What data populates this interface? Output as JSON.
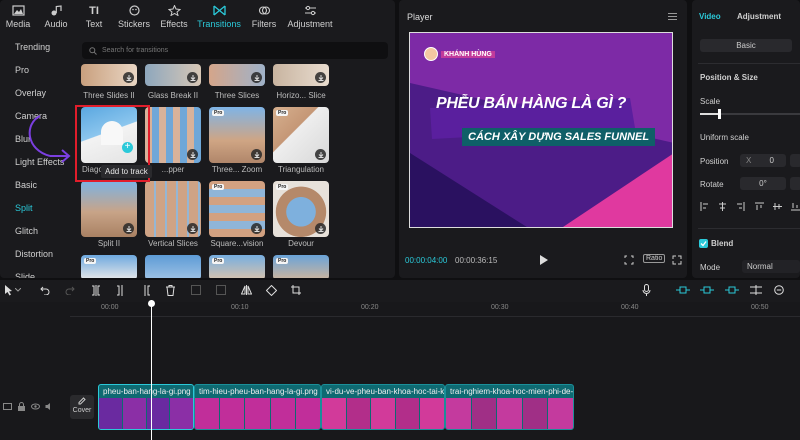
{
  "top_tabs": [
    {
      "label": "Media",
      "icon": "media-icon"
    },
    {
      "label": "Audio",
      "icon": "audio-icon"
    },
    {
      "label": "Text",
      "icon": "text-icon"
    },
    {
      "label": "Stickers",
      "icon": "stickers-icon"
    },
    {
      "label": "Effects",
      "icon": "effects-icon"
    },
    {
      "label": "Transitions",
      "icon": "transitions-icon",
      "active": true
    },
    {
      "label": "Filters",
      "icon": "filters-icon"
    },
    {
      "label": "Adjustment",
      "icon": "adjustment-icon"
    }
  ],
  "categories": [
    "Trending",
    "Pro",
    "Overlay",
    "Camera",
    "Blur",
    "Light Effects",
    "Basic",
    "Split",
    "Glitch",
    "Distortion",
    "Slide"
  ],
  "active_category": "Split",
  "search_placeholder": "Search for transitions",
  "tiles": [
    {
      "label": "Three Slides II"
    },
    {
      "label": "Glass Break II"
    },
    {
      "label": "Three Slices"
    },
    {
      "label": "Horizo... Slice"
    },
    {
      "label": "Diago..."
    },
    {
      "label": "...pper"
    },
    {
      "label": "Three... Zoom"
    },
    {
      "label": "Triangulation"
    },
    {
      "label": "Split II"
    },
    {
      "label": "Vertical Slices"
    },
    {
      "label": "Square...vision"
    },
    {
      "label": "Devour"
    }
  ],
  "tooltip": "Add to track",
  "player": {
    "title": "Player",
    "current_time": "00:00:04:00",
    "total_time": "00:00:36:15",
    "ratio_label": "Ratio",
    "video_logo": "KHÁNH HÙNG",
    "video_line1": "PHỄU BÁN HÀNG LÀ GÌ ?",
    "video_line2": "CÁCH XÂY DỰNG SALES FUNNEL"
  },
  "right_panel": {
    "tab_video": "Video",
    "tab_adjustment": "Adjustment",
    "basic_button": "Basic",
    "section_position": "Position & Size",
    "scale_label": "Scale",
    "uniform_scale": "Uniform scale",
    "position_label": "Position",
    "position_x_label": "X",
    "position_x_value": "0",
    "rotate_label": "Rotate",
    "rotate_value": "0°",
    "blend_label": "Blend",
    "mode_label": "Mode",
    "mode_value": "Normal"
  },
  "ruler": [
    "00:00",
    "00:10",
    "00:20",
    "00:30",
    "00:40",
    "00:50"
  ],
  "cover_label": "Cover",
  "clips": [
    {
      "name": "pheu-ban-hang-la-gi.png"
    },
    {
      "name": "tim-hieu-pheu-ban-hang-la-gi.png"
    },
    {
      "name": "vi-du-ve-pheu-ban-khoa-hoc-tai-kh"
    },
    {
      "name": "trai-nghiem-khoa-hoc-mien-phi-de-g"
    }
  ],
  "colors": {
    "accent": "#2bc9d9",
    "highlight_box": "#e11d2b",
    "arrow": "#7b3fe0",
    "clip_border": "#2bc9d9"
  }
}
